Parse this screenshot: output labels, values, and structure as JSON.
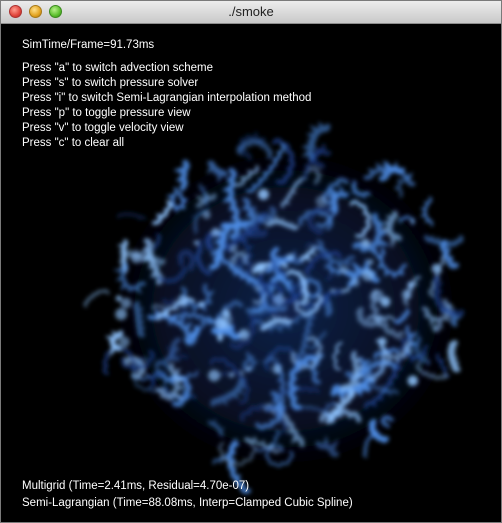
{
  "window": {
    "title": "./smoke"
  },
  "overlay": {
    "stats": "SimTime/Frame=91.73ms",
    "help": [
      "Press \"a\" to switch advection scheme",
      "Press \"s\" to switch pressure solver",
      "Press \"i\" to switch Semi-Lagrangian interpolation method",
      "Press \"p\" to toggle pressure view",
      "Press \"v\" to toggle velocity view",
      "Press \"c\" to clear all"
    ],
    "solver_status": "Multigrid (Time=2.41ms, Residual=4.70e-07)",
    "advection_status": "Semi-Lagrangian (Time=88.08ms, Interp=Clamped Cubic Spline)"
  },
  "colors": {
    "smoke_light": "#8fc4ff",
    "smoke_mid": "#4f8fe8",
    "smoke_dark": "#1d3f8a",
    "background": "#000000"
  }
}
